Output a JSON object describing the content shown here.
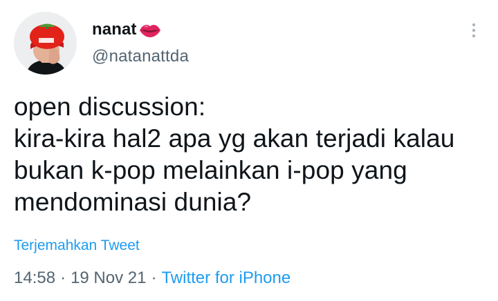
{
  "user": {
    "display_name": "nanat",
    "badge_icon": "lips-icon",
    "handle": "@natanattda",
    "avatar_hat_text": "Supreme"
  },
  "tweet": {
    "text": "open discussion:\nkira-kira hal2 apa yg akan terjadi kalau\nbukan k-pop melainkan i-pop yang\nmendominasi dunia?",
    "translate_label": "Terjemahkan Tweet",
    "time": "14:58",
    "separator": "·",
    "date": "19 Nov 21",
    "source": "Twitter for iPhone"
  },
  "colors": {
    "link": "#1d9bf0",
    "muted": "#536471",
    "text": "#0f1419",
    "lips": "#e0245e"
  }
}
